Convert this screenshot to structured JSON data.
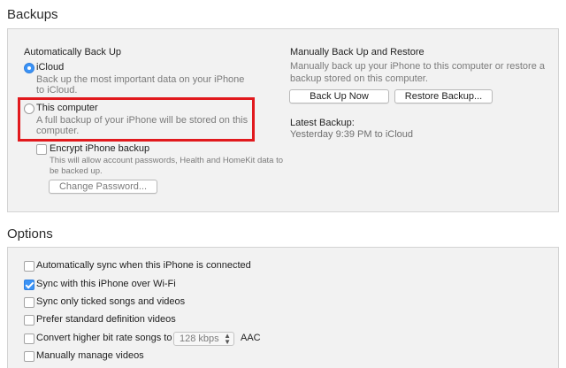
{
  "backups": {
    "heading": "Backups",
    "auto": {
      "title": "Automatically Back Up",
      "icloud_label": "iCloud",
      "icloud_desc": "Back up the most important data on your iPhone to iCloud.",
      "computer_label": "This computer",
      "computer_desc": "A full backup of your iPhone will be stored on this computer.",
      "encrypt_label": "Encrypt iPhone backup",
      "encrypt_desc": "This will allow account passwords, Health and HomeKit data to be backed up.",
      "change_password": "Change Password...",
      "selected": "iCloud",
      "encrypt_checked": false
    },
    "manual": {
      "title": "Manually Back Up and Restore",
      "desc": "Manually back up your iPhone to this computer or restore a backup stored on this computer.",
      "backup_now": "Back Up Now",
      "restore": "Restore Backup...",
      "latest_title": "Latest Backup:",
      "latest_value": "Yesterday 9:39 PM to iCloud"
    }
  },
  "options": {
    "heading": "Options",
    "items": [
      {
        "label": "Automatically sync when this iPhone is connected",
        "checked": false
      },
      {
        "label": "Sync with this iPhone over Wi-Fi",
        "checked": true
      },
      {
        "label": "Sync only ticked songs and videos",
        "checked": false
      },
      {
        "label": "Prefer standard definition videos",
        "checked": false
      },
      {
        "label": "Convert higher bit rate songs to",
        "checked": false
      },
      {
        "label": "Manually manage videos",
        "checked": false
      }
    ],
    "bitrate_value": "128 kbps",
    "bitrate_format": "AAC"
  },
  "colors": {
    "accent": "#3b93f6",
    "highlight": "#e1191d"
  }
}
